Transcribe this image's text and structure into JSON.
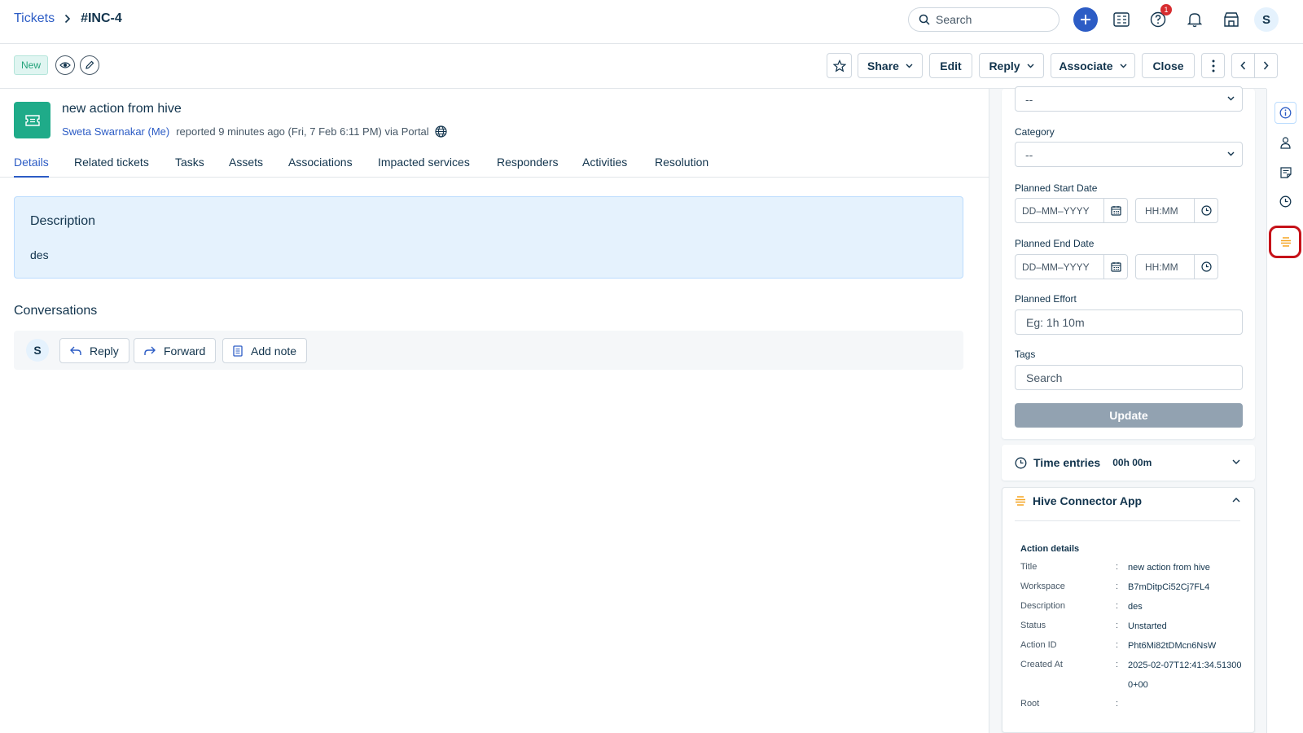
{
  "breadcrumb": {
    "parent": "Tickets",
    "separator": ">",
    "current": "#INC-4"
  },
  "topbar": {
    "search_placeholder": "Search",
    "notification_count": "1",
    "avatar_initial": "S",
    "colors": {
      "primary": "#2c5cc5",
      "badge": "#d72d30"
    }
  },
  "toolbar": {
    "status": "New",
    "share": "Share",
    "edit": "Edit",
    "reply": "Reply",
    "associate": "Associate",
    "close": "Close"
  },
  "ticket": {
    "title": "new action from hive",
    "requester": "Sweta Swarnakar (Me)",
    "meta": "reported 9 minutes ago (Fri, 7 Feb 6:11 PM) via Portal",
    "icon_color": "#1fab89"
  },
  "tabs": [
    "Details",
    "Related tickets",
    "Tasks",
    "Assets",
    "Associations",
    "Impacted services",
    "Responders",
    "Activities",
    "Resolution"
  ],
  "active_tab": "Details",
  "description": {
    "heading": "Description",
    "body": "des"
  },
  "conversations": {
    "heading": "Conversations",
    "avatar_initial": "S",
    "reply": "Reply",
    "forward": "Forward",
    "add_note": "Add note"
  },
  "properties": {
    "top_select_value": "--",
    "category_label": "Category",
    "category_value": "--",
    "planned_start_label": "Planned Start Date",
    "planned_end_label": "Planned End Date",
    "date_placeholder": "DD–MM–YYYY",
    "time_placeholder": "HH:MM",
    "planned_effort_label": "Planned Effort",
    "planned_effort_placeholder": "Eg: 1h 10m",
    "tags_label": "Tags",
    "tags_placeholder": "Search",
    "update": "Update"
  },
  "time_entries": {
    "label": "Time entries",
    "value": "00h 00m"
  },
  "hive_app": {
    "title": "Hive Connector App",
    "section": "Action details",
    "separator": ":",
    "rows": [
      {
        "key": "Title",
        "value": "new action from hive"
      },
      {
        "key": "Workspace",
        "value": "B7mDitpCi52Cj7FL4"
      },
      {
        "key": "Description",
        "value": "des"
      },
      {
        "key": "Status",
        "value": "Unstarted"
      },
      {
        "key": "Action ID",
        "value": "Pht6Mi82tDMcn6NsW"
      },
      {
        "key": "Created At",
        "value": "2025-02-07T12:41:34.513000+00"
      },
      {
        "key": "Root",
        "value": ""
      }
    ],
    "accent_color": "#f5a623"
  },
  "rail_icons": [
    "info-icon",
    "user-icon",
    "note-icon",
    "clock-icon",
    "hive-app-icon"
  ]
}
